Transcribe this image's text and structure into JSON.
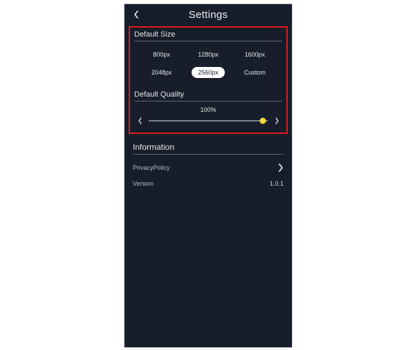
{
  "header": {
    "title": "Settings"
  },
  "default_size": {
    "heading": "Default Size",
    "options": [
      "800px",
      "1280px",
      "1600px",
      "2048px",
      "2560px",
      "Custom"
    ],
    "selected_index": 4
  },
  "default_quality": {
    "heading": "Default Quality",
    "value_label": "100%",
    "percent": 100
  },
  "information": {
    "heading": "Information",
    "privacy_label": "PrivacyPolicy",
    "version_label": "Version",
    "version_value": "1.0.1"
  },
  "colors": {
    "background": "#181d2b",
    "accent": "#f4d83b",
    "highlight_box": "#e11b1b"
  }
}
